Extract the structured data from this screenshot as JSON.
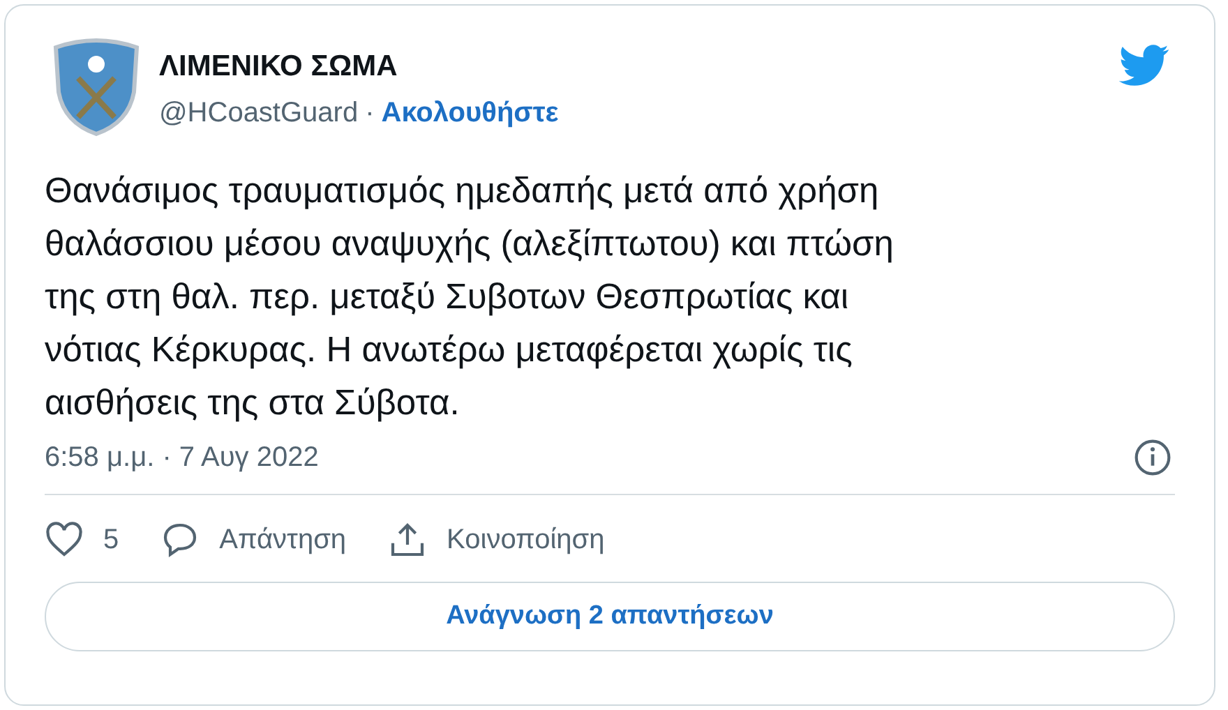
{
  "author": {
    "name": "ΛΙΜΕΝΙΚΟ ΣΩΜΑ",
    "handle": "@HCoastGuard",
    "separator": "·",
    "follow": "Ακολουθήστε"
  },
  "text": "Θανάσιμος τραυματισμός ημεδαπής μετά από χρήση\nθαλάσσιου μέσου αναψυχής (αλεξίπτωτου) και πτώση\nτης στη θαλ. περ. μεταξύ Συβοτων Θεσπρωτίας και\nνότιας Κέρκυρας. Η ανωτέρω μεταφέρεται χωρίς τις\nαισθήσεις της στα Σύβοτα.",
  "timestamp": "6:58 μ.μ. · 7 Αυγ 2022",
  "actions": [
    {
      "kind": "like",
      "label": "5"
    },
    {
      "kind": "reply",
      "label": "Απάντηση"
    },
    {
      "kind": "share",
      "label": "Κοινοποίηση"
    }
  ],
  "read_replies": "Ανάγνωση 2 απαντήσεων"
}
